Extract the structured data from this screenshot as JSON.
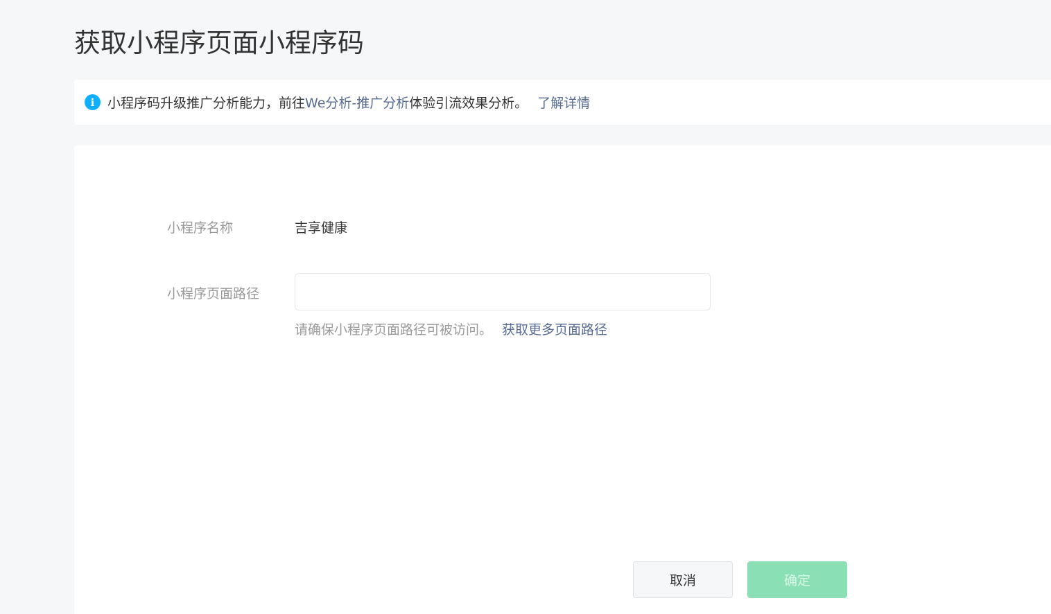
{
  "page": {
    "title": "获取小程序页面小程序码"
  },
  "notice": {
    "icon": "info-icon",
    "icon_glyph": "i",
    "icon_color": "#10aeff",
    "text_before": "小程序码升级推广分析能力，前往",
    "analysis_link": "We分析-推广分析",
    "text_after": "体验引流效果分析。",
    "details_link": "了解详情"
  },
  "form": {
    "name_label": "小程序名称",
    "name_value": "吉享健康",
    "path_label": "小程序页面路径",
    "path_value": "",
    "path_hint": "请确保小程序页面路径可被访问。",
    "more_paths_link": "获取更多页面路径"
  },
  "actions": {
    "cancel_label": "取消",
    "confirm_label": "确定",
    "confirm_color": "#8ae0b4"
  },
  "colors": {
    "link": "#576b95",
    "background": "#f6f7f9"
  }
}
